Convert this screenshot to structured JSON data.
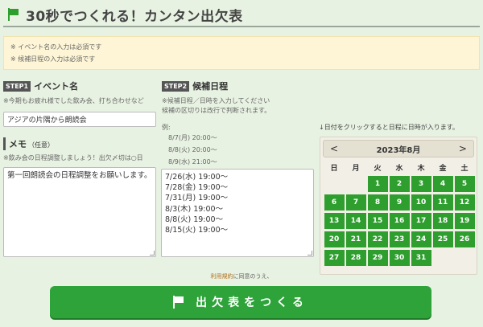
{
  "header": {
    "title": "30秒でつくれる！カンタン出欠表",
    "icon": "flag-icon",
    "accent": "#2e9e2e"
  },
  "notice": [
    "※ イベント名の入力は必須です",
    "※ 候補日程の入力は必須です"
  ],
  "step1": {
    "badge": "STEP1",
    "label": "イベント名",
    "hint": "※今期もお疲れ様でした飲み会、打ち合わせなど",
    "value": "アジアの片隅から朗読会"
  },
  "memo": {
    "label": "メモ",
    "sub": "（任意）",
    "hint": "※飲み会の日程調整しましょう！出欠〆切は○日",
    "lines": [
      "第一回朗読会の日程調整をお願いします。"
    ]
  },
  "step2": {
    "badge": "STEP2",
    "label": "候補日程",
    "hint1": "※候補日程／日時を入力してください",
    "hint2": "候補の区切りは改行で判断されます。",
    "example_label": "例:",
    "examples": [
      "8/7(月) 20:00～",
      "8/8(火) 20:00～",
      "8/9(水) 21:00～"
    ],
    "lines": [
      "7/26(水) 19:00～",
      "7/28(金) 19:00～",
      "7/31(月) 19:00～",
      "8/3(木) 19:00～",
      "8/8(火) 19:00～",
      "8/15(火) 19:00～"
    ]
  },
  "calendar": {
    "hint": "↓日付をクリックすると日程に日時が入ります。",
    "prev": "<",
    "next": ">",
    "month": "2023年8月",
    "weekdays": [
      "日",
      "月",
      "火",
      "水",
      "木",
      "金",
      "土"
    ],
    "first_weekday": 2,
    "days": [
      "1",
      "2",
      "3",
      "4",
      "5",
      "6",
      "7",
      "8",
      "9",
      "10",
      "11",
      "12",
      "13",
      "14",
      "15",
      "16",
      "17",
      "18",
      "19",
      "20",
      "21",
      "22",
      "23",
      "24",
      "25",
      "26",
      "27",
      "28",
      "29",
      "30",
      "31"
    ],
    "day_color": "#2e9e2e"
  },
  "terms": {
    "link": "利用規約",
    "text": "に同意のうえ、"
  },
  "cta": {
    "label": "出欠表をつくる",
    "icon": "flag-icon",
    "color": "#2ea33a"
  }
}
